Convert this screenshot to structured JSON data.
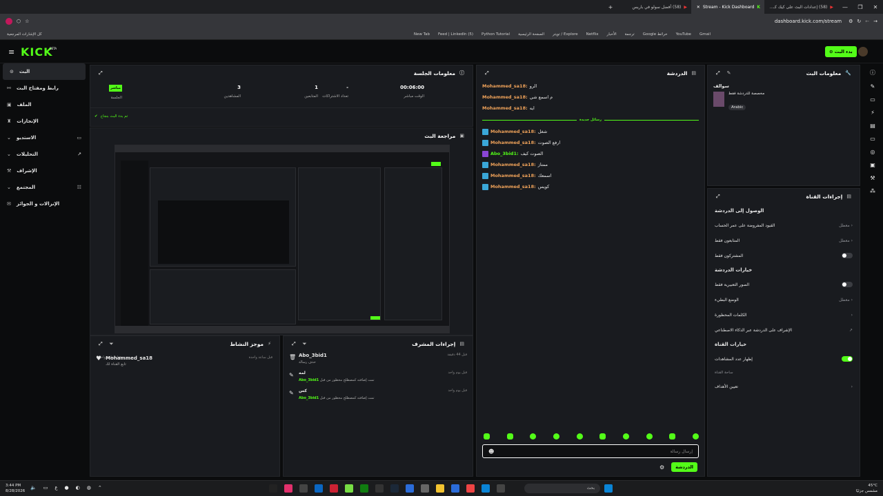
{
  "browser": {
    "tabs": [
      {
        "label": "(58) إعدادات البث على كيك كـ..."
      },
      {
        "label": "Stream - Kick Dashboard",
        "active": true
      },
      {
        "label": "(58) أفضل سولو في باريس"
      }
    ],
    "new_tab": "+",
    "url": "dashboard.kick.com/stream",
    "bookmarks": [
      "Gmail",
      "YouTube",
      "خرائط Google",
      "ترجمة",
      "الأخبار",
      "Netflix",
      "Explore / تويتر",
      "الصفحة الرئيسية",
      "Python Tutorial",
      "(5) Feed | LinkedIn",
      "New Tab"
    ],
    "all_bookmarks": "كل الإشارات المرجعية"
  },
  "topbar": {
    "logo": "KICK",
    "logo_beta": "BETA",
    "go_live": "بدء البث"
  },
  "sidebar": {
    "items": [
      {
        "label": "البث",
        "active": true
      },
      {
        "label": "رابط ومفتاح البث"
      },
      {
        "label": "الملف"
      },
      {
        "label": "الإنجازات"
      },
      {
        "label": "الاستديو"
      },
      {
        "label": "التحليلات"
      },
      {
        "label": "الإشراف"
      },
      {
        "label": "المجتمع"
      },
      {
        "label": "الإنزالات و الجوائز"
      }
    ]
  },
  "session": {
    "title": "معلومات الجلسة",
    "live_badge": "مباشر",
    "stats": [
      {
        "value": "00:06:00",
        "label": "الوقت مباشر"
      },
      {
        "value": "-",
        "label": "تعداد الاشتراكات"
      },
      {
        "value": "1",
        "label": "المتابعين"
      },
      {
        "value": "3",
        "label": "المشاهدين"
      },
      {
        "value": "",
        "label": "الجلسة"
      }
    ],
    "status": "تم بدء البث بنجاح"
  },
  "preview": {
    "title": "مراجعة البث"
  },
  "activity": {
    "title": "موجز النشاط",
    "items": [
      {
        "user": "Mohammed_sa18",
        "text": "تابع القناة لك",
        "time": "قبل ساعة واحدة"
      }
    ]
  },
  "mod_actions": {
    "title": "إجراءات المشرف",
    "items": [
      {
        "user": "Abo_3bid1",
        "text": "حذف رسالة",
        "time": "قبل 44 دقيقة"
      },
      {
        "word": "لمه",
        "text": "تمت إضافته كمصطلح محظور من قبل",
        "by": "Abo_3bid1",
        "time": "قبل يوم واحد"
      },
      {
        "word": "كس",
        "text": "تمت إضافته كمصطلح محظور من قبل",
        "by": "Abo_3bid1",
        "time": "قبل يوم واحد"
      }
    ]
  },
  "chat": {
    "title": "الدردشة",
    "messages_old": [
      {
        "user": "Mohammed_sa18:",
        "text": "الرو"
      },
      {
        "user": "Mohammed_sa18:",
        "text": "م اسمع شي"
      },
      {
        "user": "Mohammed_sa18:",
        "text": "ايه"
      }
    ],
    "divider": "رسائل جديدة",
    "messages_new": [
      {
        "user": "Mohammed_sa18:",
        "text": "شغل"
      },
      {
        "user": "Mohammed_sa18:",
        "text": "ارفع الصوت"
      },
      {
        "user": "Abo_3bid1:",
        "text": "الصوت كيف",
        "mod": true
      },
      {
        "user": "Mohammed_sa18:",
        "text": "ممتاز"
      },
      {
        "user": "Mohammed_sa18:",
        "text": "اسمعك"
      },
      {
        "user": "Mohammed_sa18:",
        "text": "كويس"
      }
    ],
    "input_placeholder": "إرسال رسالة",
    "send": "الدردشة"
  },
  "stream_info": {
    "title": "معلومات البث",
    "category": "سوالف",
    "desc": "مخصصة للدردشة فقط",
    "language": "Arabic"
  },
  "channel_actions": {
    "title": "إجراءات القناة",
    "chat_access": "الوصول إلى الدردشة",
    "rows1": [
      {
        "label": "القيود المفروضة على عمر الحساب",
        "value": "معطل",
        "type": "arrow"
      },
      {
        "label": "المتابعون فقط",
        "value": "معطل",
        "type": "arrow"
      },
      {
        "label": "المشتركون فقط",
        "type": "toggle",
        "on": false
      }
    ],
    "chat_options": "خيارات الدردشة",
    "rows2": [
      {
        "label": "الصور التعبيرية فقط",
        "type": "toggle",
        "on": false
      },
      {
        "label": "الوضع البطيء",
        "value": "معطل",
        "type": "arrow"
      },
      {
        "label": "الكلمات المحظورة",
        "type": "arrow"
      },
      {
        "label": "الإشراف على الدردشة عبر الذكاء الاصطناعي",
        "type": "ext"
      }
    ],
    "channel_options": "خيارات القناة",
    "rows3": [
      {
        "label": "إظهار عدد المشاهدات",
        "type": "toggle",
        "on": true
      }
    ],
    "channel_points": "ساحة القناة",
    "rows4": [
      {
        "label": "تعيين الأهداف",
        "type": "arrow"
      }
    ]
  },
  "taskbar": {
    "time": "3:44 PM",
    "date": "8/28/2026",
    "weather": "45°C",
    "weather_desc": "مشمس جزئيًا",
    "search": "بحث"
  }
}
